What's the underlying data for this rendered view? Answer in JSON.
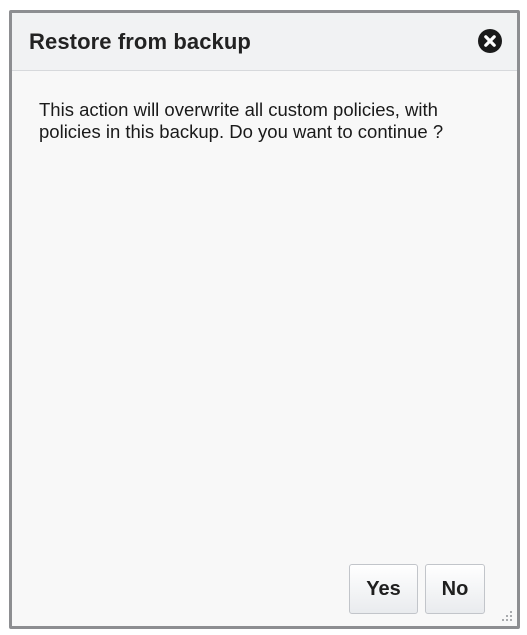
{
  "dialog": {
    "title": "Restore from backup",
    "message": "This action will overwrite all custom policies, with policies in this backup. Do you want to continue ?",
    "buttons": {
      "yes_label": "Yes",
      "no_label": "No"
    },
    "icons": {
      "close": "close-circle-icon",
      "resize": "resize-grip-icon"
    },
    "colors": {
      "border": "#8d8e91",
      "background": "#f8f8f8",
      "header_background": "#f1f2f3",
      "text": "#1a1a1a"
    }
  }
}
